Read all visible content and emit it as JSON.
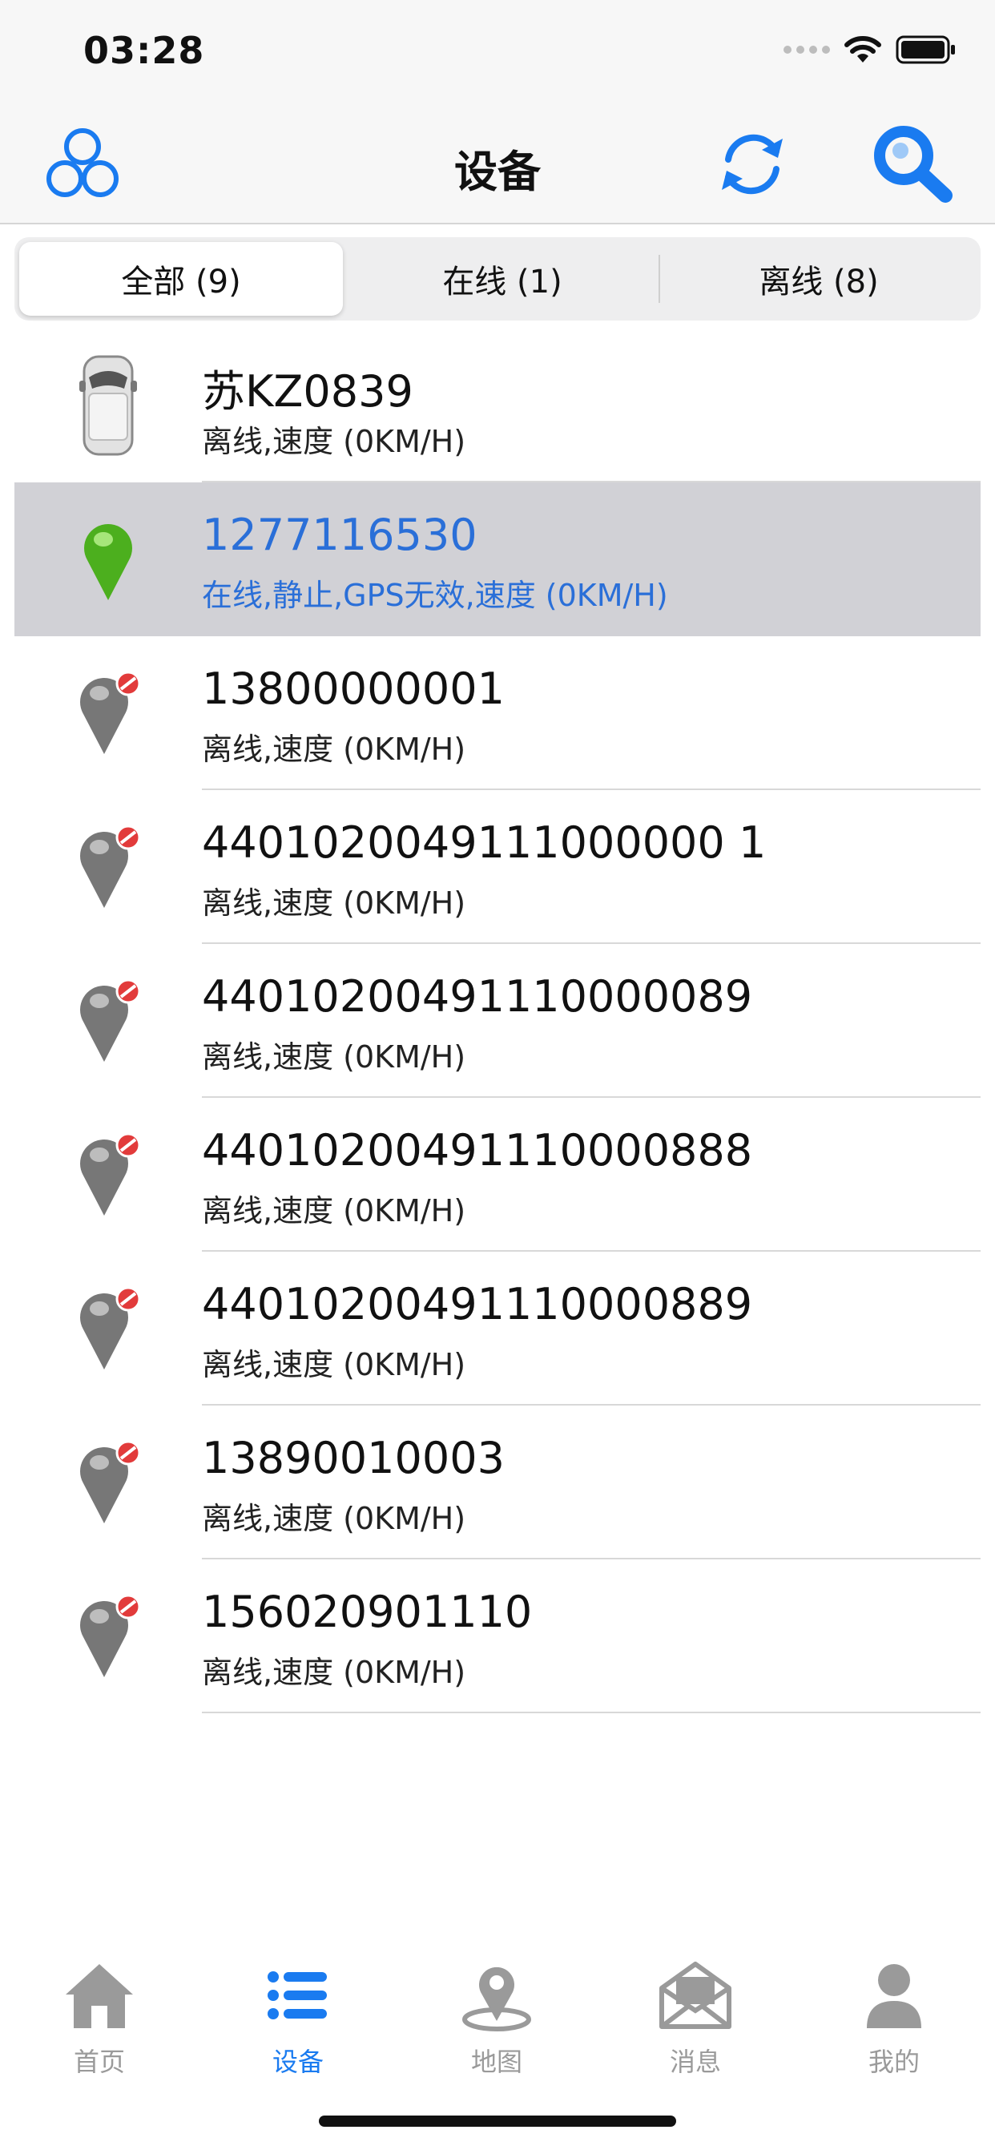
{
  "status_bar": {
    "time": "03:28"
  },
  "nav": {
    "title": "设备"
  },
  "segments": [
    {
      "label": "全部 (9)",
      "active": true
    },
    {
      "label": "在线 (1)",
      "active": false
    },
    {
      "label": "离线 (8)",
      "active": false
    }
  ],
  "devices": [
    {
      "name": "苏KZ0839",
      "status": "离线,速度 (0KM/H)",
      "icon": "van-icon",
      "selected": false
    },
    {
      "name": "1277116530",
      "status": "在线,静止,GPS无效,速度 (0KM/H)",
      "icon": "green-pin-icon",
      "selected": true
    },
    {
      "name": "13800000001",
      "status": "离线,速度 (0KM/H)",
      "icon": "gray-pin-offline-icon",
      "selected": false
    },
    {
      "name": "4401020049111000000 1",
      "status": "离线,速度 (0KM/H)",
      "icon": "gray-pin-offline-icon",
      "selected": false
    },
    {
      "name": "44010200491110000089",
      "status": "离线,速度 (0KM/H)",
      "icon": "gray-pin-offline-icon",
      "selected": false
    },
    {
      "name": "44010200491110000888",
      "status": "离线,速度 (0KM/H)",
      "icon": "gray-pin-offline-icon",
      "selected": false
    },
    {
      "name": "44010200491110000889",
      "status": "离线,速度 (0KM/H)",
      "icon": "gray-pin-offline-icon",
      "selected": false
    },
    {
      "name": "13890010003",
      "status": "离线,速度 (0KM/H)",
      "icon": "gray-pin-offline-icon",
      "selected": false
    },
    {
      "name": "156020901110",
      "status": "离线,速度 (0KM/H)",
      "icon": "gray-pin-offline-icon",
      "selected": false
    }
  ],
  "tabs": [
    {
      "label": "首页",
      "icon": "home-icon",
      "active": false
    },
    {
      "label": "设备",
      "icon": "list-icon",
      "active": true
    },
    {
      "label": "地图",
      "icon": "map-pin-icon",
      "active": false
    },
    {
      "label": "消息",
      "icon": "mail-icon",
      "active": false
    },
    {
      "label": "我的",
      "icon": "person-icon",
      "active": false
    }
  ],
  "colors": {
    "accent": "#1a7bf0",
    "selected_row": "#d1d1d6",
    "selected_text": "#2a6fd8",
    "inactive_tab": "#9a9a9a"
  }
}
